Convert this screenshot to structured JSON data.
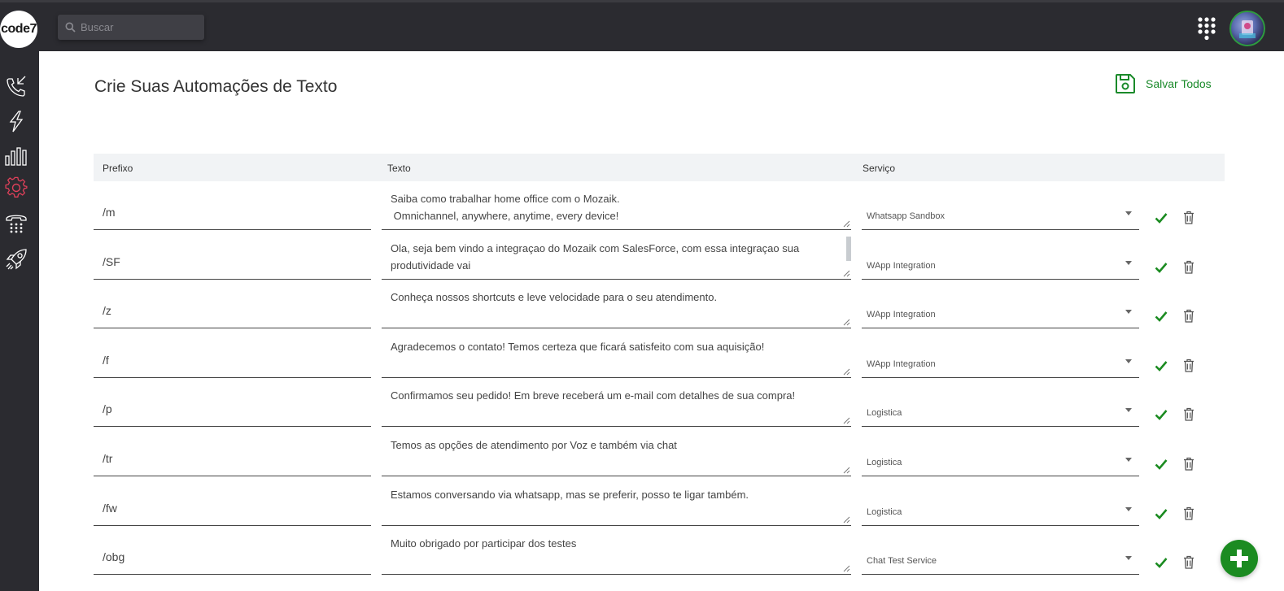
{
  "app": {
    "logo_text": "code7"
  },
  "search": {
    "placeholder": "Buscar",
    "value": ""
  },
  "sidebar": {
    "items": [
      {
        "name": "phone-calls-icon",
        "active": false
      },
      {
        "name": "lightning-icon",
        "active": false
      },
      {
        "name": "bar-chart-icon",
        "active": false
      },
      {
        "name": "gear-icon",
        "active": true
      },
      {
        "name": "telephone-keypad-icon",
        "active": false
      },
      {
        "name": "rocket-icon",
        "active": false
      }
    ]
  },
  "page": {
    "title": "Crie Suas Automações de Texto"
  },
  "toolbar": {
    "save_all_label": "Salvar Todos"
  },
  "table": {
    "headers": {
      "prefix": "Prefixo",
      "text": "Texto",
      "service": "Serviço"
    },
    "rows": [
      {
        "prefix": "/m",
        "text": "Saiba como trabalhar home office com o Mozaik.\n Omnichannel, anywhere, anytime, every device!",
        "service": "Whatsapp Sandbox"
      },
      {
        "prefix": "/SF",
        "text": "Ola, seja bem vindo a integraçao do Mozaik com SalesForce, com essa integraçao sua produtividade vai",
        "service": "WApp Integration"
      },
      {
        "prefix": "/z",
        "text": "Conheça nossos shortcuts e leve velocidade para o seu atendimento.",
        "service": "WApp Integration"
      },
      {
        "prefix": "/f",
        "text": "Agradecemos o contato! Temos certeza que ficará satisfeito com sua aquisição!",
        "service": "WApp Integration"
      },
      {
        "prefix": "/p",
        "text": "Confirmamos seu pedido! Em breve receberá um e-mail com detalhes de sua compra!",
        "service": "Logistica"
      },
      {
        "prefix": "/tr",
        "text": "Temos as opções de atendimento por Voz e também via chat",
        "service": "Logistica"
      },
      {
        "prefix": "/fw",
        "text": "Estamos conversando via whatsapp, mas se preferir, posso te ligar também.",
        "service": "Logistica"
      },
      {
        "prefix": "/obg",
        "text": "Muito obrigado por participar dos testes",
        "service": "Chat Test Service"
      }
    ]
  },
  "colors": {
    "accent_green": "#1b8b21",
    "active_icon": "#e0405a",
    "topbar": "#2b2b30"
  }
}
